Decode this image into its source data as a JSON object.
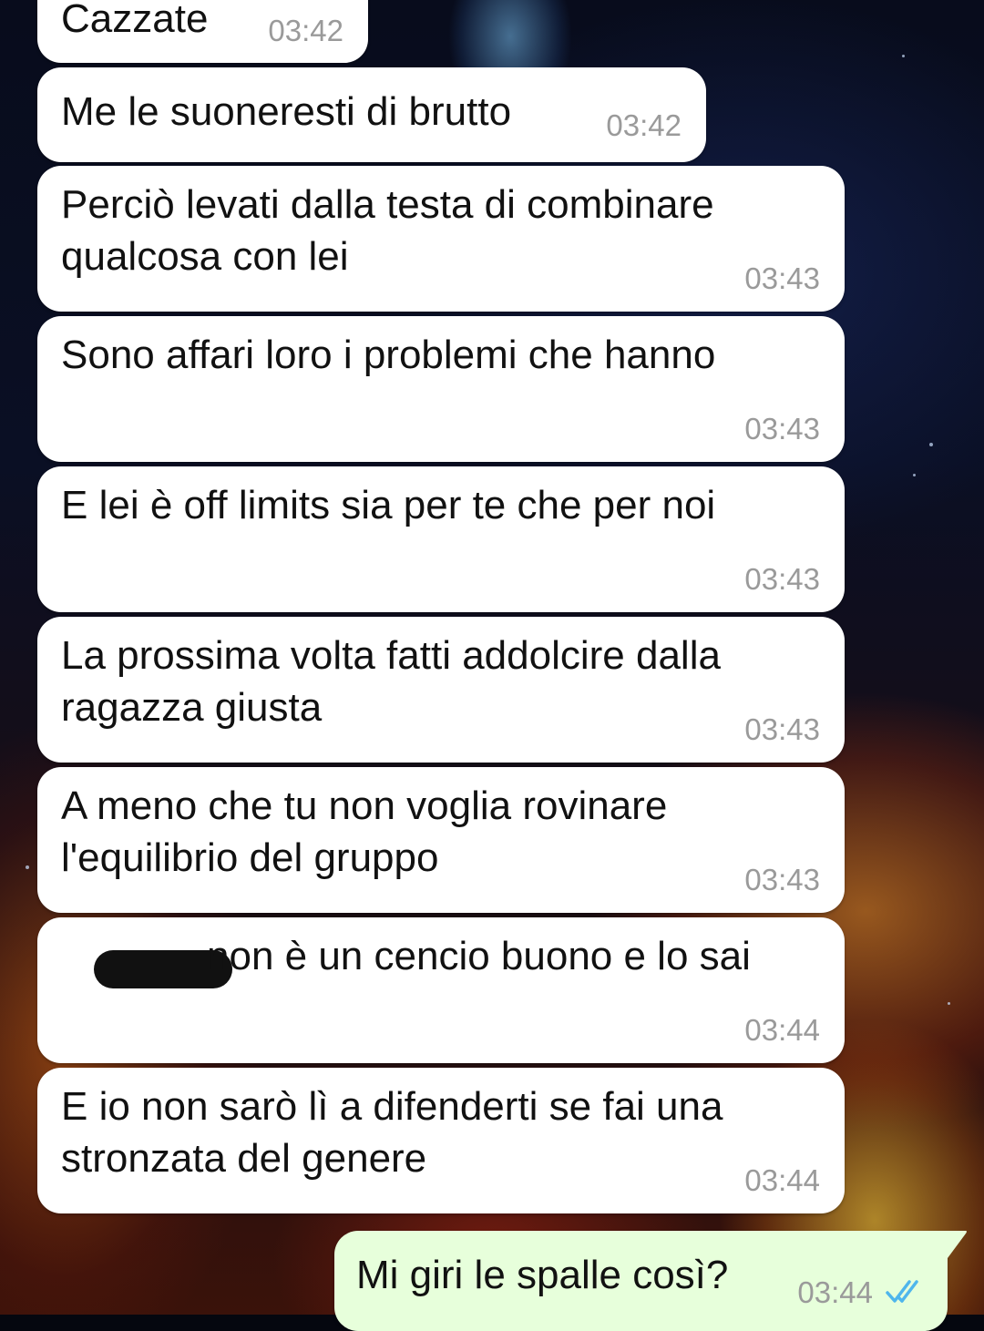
{
  "messages": [
    {
      "text": "Cazzate",
      "time": "03:42",
      "direction": "incoming"
    },
    {
      "text": "Me le suoneresti di brutto",
      "time": "03:42",
      "direction": "incoming"
    },
    {
      "text": "Perciò levati dalla testa di combinare qualcosa con lei",
      "time": "03:43",
      "direction": "incoming"
    },
    {
      "text": "Sono affari loro i problemi che hanno",
      "time": "03:43",
      "direction": "incoming"
    },
    {
      "text": "E lei è off limits sia per te che per noi",
      "time": "03:43",
      "direction": "incoming"
    },
    {
      "text": "La prossima volta fatti addolcire dalla ragazza giusta",
      "time": "03:43",
      "direction": "incoming"
    },
    {
      "text": "A meno che tu non voglia rovinare l'equilibrio del gruppo",
      "time": "03:43",
      "direction": "incoming"
    },
    {
      "text": "non è un cencio buono e lo sai",
      "time": "03:44",
      "direction": "incoming",
      "redacted_prefix": true
    },
    {
      "text": "E io non sarò lì a difenderti se fai una stronzata del genere",
      "time": "03:44",
      "direction": "incoming"
    },
    {
      "text": "Mi giri le spalle così?",
      "time": "03:44",
      "direction": "outgoing",
      "status": "read",
      "status_icon": "double-check-icon"
    }
  ],
  "colors": {
    "incoming_bubble": "#ffffff",
    "outgoing_bubble": "#e7ffdb",
    "message_text": "#111111",
    "timestamp": "#9a9a9a",
    "read_ticks": "#4fb6ec"
  }
}
